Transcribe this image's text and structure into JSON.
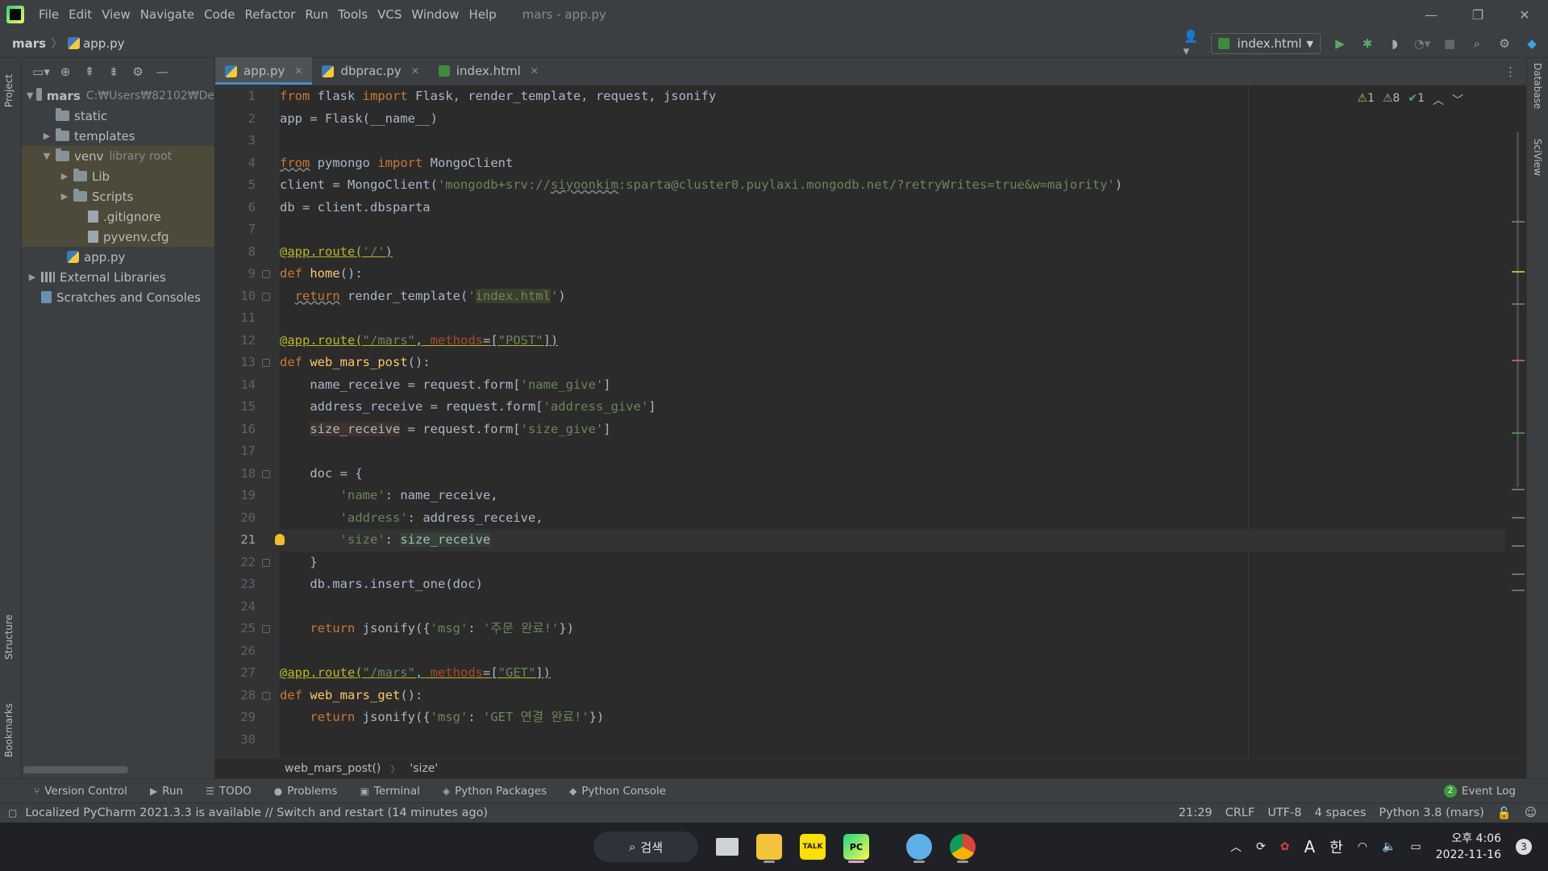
{
  "menu": {
    "items": [
      "File",
      "Edit",
      "View",
      "Navigate",
      "Code",
      "Refactor",
      "Run",
      "Tools",
      "VCS",
      "Window",
      "Help"
    ],
    "title": "mars - app.py"
  },
  "nav": {
    "project": "mars",
    "file": "app.py",
    "run_config": "index.html"
  },
  "side": {
    "project_label": "Project",
    "structure_label": "Structure",
    "bookmarks_label": "Bookmarks",
    "database_label": "Database",
    "sciview_label": "SciView"
  },
  "tree": {
    "root": "mars",
    "root_path": "C:₩Users₩82102₩De",
    "static": "static",
    "templates": "templates",
    "venv": "venv",
    "venv_hint": "library root",
    "lib": "Lib",
    "scripts": "Scripts",
    "gitignore": ".gitignore",
    "pyvenv": "pyvenv.cfg",
    "app": "app.py",
    "external": "External Libraries",
    "scratches": "Scratches and Consoles"
  },
  "tabs": [
    "app.py",
    "dbprac.py",
    "index.html"
  ],
  "inspections": {
    "warn": "1",
    "weak": "8",
    "ok": "1"
  },
  "code": {
    "l1a": "from",
    "l1b": " flask ",
    "l1c": "import",
    "l1d": " Flask, render_template, request, jsonify",
    "l2": "app = Flask(__name__)",
    "l4a": "from",
    "l4b": " pymongo ",
    "l4c": "import",
    "l4d": " MongoClient",
    "l5a": "client = MongoClient(",
    "l5b": "'mongodb+srv://",
    "l5c": "siyoonkim",
    "l5d": ":sparta@cluster0.puylaxi.mongodb.net/?retryWrites=true&w=majority'",
    "l5e": ")",
    "l6": "db = client.dbsparta",
    "l8a": "@app.route(",
    "l8b": "'/'",
    "l8c": ")",
    "l9a": "def",
    "l9b": " home",
    "l9c": "():",
    "l10a": "return",
    "l10b": " render_template(",
    "l10c": "'",
    "l10d": "index.html",
    "l10e": "'",
    "l10f": ")",
    "l12a": "@app.route(",
    "l12b": "\"/mars\"",
    "l12c": ", ",
    "l12d": "methods",
    "l12e": "=[",
    "l12f": "\"POST\"",
    "l12g": "])",
    "l13a": "def",
    "l13b": " web_mars_post",
    "l13c": "():",
    "l14a": "    name_receive = request.form[",
    "l14b": "'name_give'",
    "l14c": "]",
    "l15a": "    address_receive = request.form[",
    "l15b": "'address_give'",
    "l15c": "]",
    "l16a": "size_receive",
    "l16b": " = request.form[",
    "l16c": "'size_give'",
    "l16d": "]",
    "l18": "    doc = {",
    "l19a": "'name'",
    "l19b": ": name_receive,",
    "l20a": "'address'",
    "l20b": ": address_receive,",
    "l21a": "'size'",
    "l21b": ": ",
    "l21c": "size_receive",
    "l22": "    }",
    "l23": "    db.mars.insert_one(doc)",
    "l25a": "return",
    "l25b": " jsonify({",
    "l25c": "'msg'",
    "l25d": ": ",
    "l25e": "'주문 완료!'",
    "l25f": "})",
    "l27a": "@app.route(",
    "l27b": "\"/mars\"",
    "l27c": ", ",
    "l27d": "methods",
    "l27e": "=[",
    "l27f": "\"GET\"",
    "l27g": "])",
    "l28a": "def",
    "l28b": " web_mars_get",
    "l28c": "():",
    "l29a": "return",
    "l29b": " jsonify({",
    "l29c": "'msg'",
    "l29d": ": ",
    "l29e": "'GET 연결 완료!'",
    "l29f": "})"
  },
  "line_numbers": [
    "1",
    "2",
    "3",
    "4",
    "5",
    "6",
    "7",
    "8",
    "9",
    "10",
    "11",
    "12",
    "13",
    "14",
    "15",
    "16",
    "17",
    "18",
    "19",
    "20",
    "21",
    "22",
    "23",
    "24",
    "25",
    "26",
    "27",
    "28",
    "29",
    "30"
  ],
  "code_breadcrumb": {
    "fn": "web_mars_post()",
    "key": "'size'"
  },
  "toolwindows": [
    "Version Control",
    "Run",
    "TODO",
    "Problems",
    "Terminal",
    "Python Packages",
    "Python Console"
  ],
  "event_log": {
    "count": "2",
    "label": "Event Log"
  },
  "status": {
    "message": "Localized PyCharm 2021.3.3 is available // Switch and restart (14 minutes ago)",
    "position": "21:29",
    "line_sep": "CRLF",
    "encoding": "UTF-8",
    "indent": "4 spaces",
    "interpreter": "Python 3.8 (mars)"
  },
  "taskbar": {
    "search": "검색",
    "ime": "A",
    "lang": "한",
    "time": "오후 4:06",
    "date": "2022-11-16",
    "notifications": "3",
    "kakao": "TALK",
    "pc": "PC"
  },
  "colors": {
    "accent": "#4a88c7",
    "keyword": "#cc7832",
    "string": "#6a8759",
    "decorator": "#bbb529"
  }
}
